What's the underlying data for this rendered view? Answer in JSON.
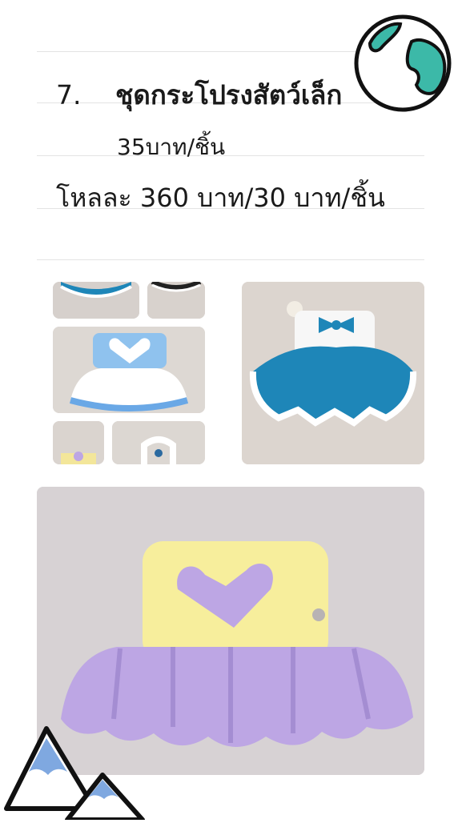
{
  "heading": {
    "number": "7.",
    "title": "ชุดกระโปรงสัตว์เล็ก"
  },
  "price_line": "35บาท/ชิ้น",
  "wholesale_line": "โหลละ 360 บาท/30 บาท/ชิ้น",
  "colors": {
    "blue_yarn": "#1e86b8",
    "light_blue_yarn": "#8fc2ee",
    "yellow_yarn": "#f7ee9c",
    "purple_yarn": "#bda6e4",
    "globe_fill": "#3cb9a8",
    "mountain_fill": "#7fa8e0"
  },
  "icons": [
    "globe-sticker-icon",
    "mountains-sticker-icon"
  ]
}
